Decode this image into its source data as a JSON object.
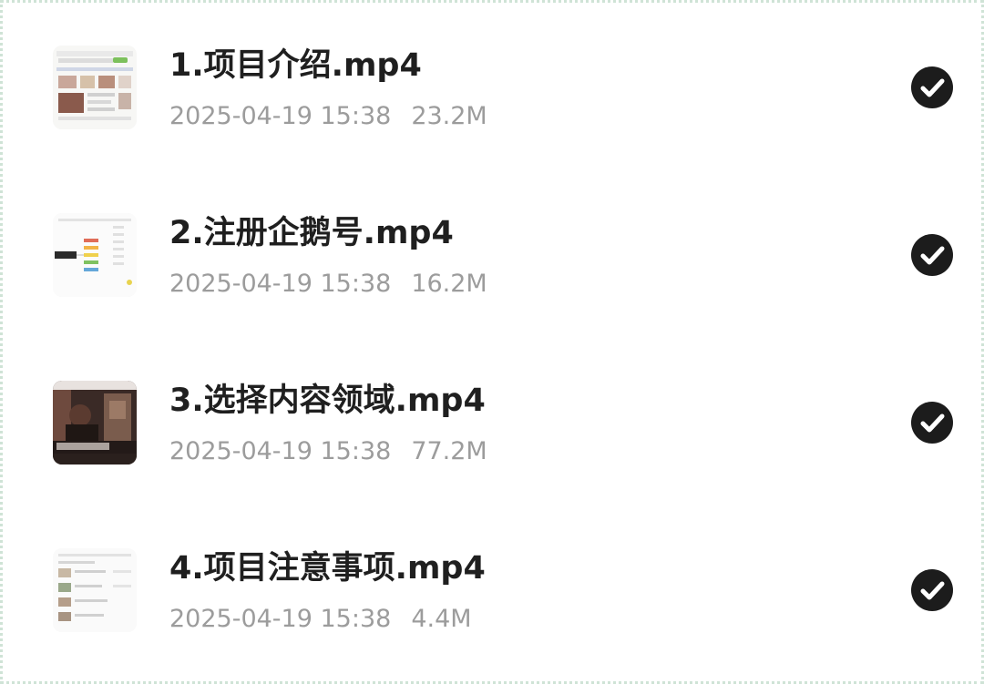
{
  "files": [
    {
      "name": "1.项目介绍.mp4",
      "date": "2025-04-19 15:38",
      "size": "23.2M",
      "thumbnail_icon": "video-thumbnail-website",
      "selected": true,
      "check_icon": "checkmark-circle-icon"
    },
    {
      "name": "2.注册企鹅号.mp4",
      "date": "2025-04-19 15:38",
      "size": "16.2M",
      "thumbnail_icon": "video-thumbnail-mindmap",
      "selected": true,
      "check_icon": "checkmark-circle-icon"
    },
    {
      "name": "3.选择内容领域.mp4",
      "date": "2025-04-19 15:38",
      "size": "77.2M",
      "thumbnail_icon": "video-thumbnail-photo",
      "selected": true,
      "check_icon": "checkmark-circle-icon"
    },
    {
      "name": "4.项目注意事项.mp4",
      "date": "2025-04-19 15:38",
      "size": "4.4M",
      "thumbnail_icon": "video-thumbnail-document",
      "selected": true,
      "check_icon": "checkmark-circle-icon"
    }
  ],
  "colors": {
    "title": "#1f1f1f",
    "meta": "#9c9c9c",
    "check": "#1c1c1c",
    "border": "#cfe3d6"
  }
}
